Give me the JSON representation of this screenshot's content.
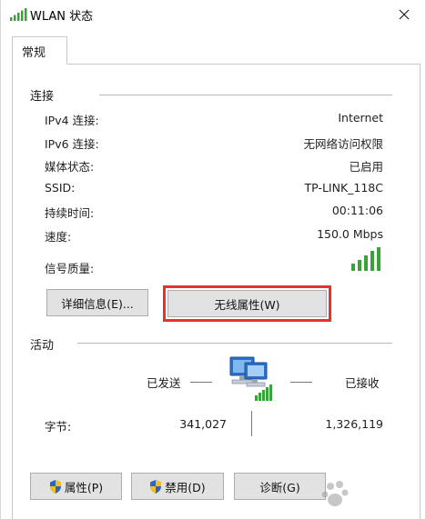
{
  "window": {
    "title": "WLAN 状态"
  },
  "tabs": [
    {
      "label": "常规"
    }
  ],
  "connection": {
    "header": "连接",
    "rows": [
      {
        "label": "IPv4 连接:",
        "value": "Internet"
      },
      {
        "label": "IPv6 连接:",
        "value": "无网络访问权限"
      },
      {
        "label": "媒体状态:",
        "value": "已启用"
      },
      {
        "label": "SSID:",
        "value": "TP-LINK_118C"
      },
      {
        "label": "持续时间:",
        "value": "00:11:06"
      },
      {
        "label": "速度:",
        "value": "150.0 Mbps"
      }
    ],
    "signal_label": "信号质量:",
    "signal_bars": 5,
    "details_button": "详细信息(E)...",
    "wireless_props_button": "无线属性(W)"
  },
  "activity": {
    "header": "活动",
    "sent_label": "已发送",
    "received_label": "已接收",
    "bytes_label": "字节:",
    "bytes_sent": "341,027",
    "bytes_received": "1,326,119"
  },
  "buttons": {
    "properties": "属性(P)",
    "disable": "禁用(D)",
    "diagnose": "诊断(G)"
  },
  "icons": {
    "title": "wifi-signal-icon",
    "close": "close-icon",
    "signal": "signal-strength-icon",
    "network": "network-computer-icon",
    "shield": "uac-shield-icon"
  },
  "colors": {
    "signal_green": "#3aa23a",
    "highlight_red": "#e53333",
    "button_bg": "#e2e2e2"
  }
}
